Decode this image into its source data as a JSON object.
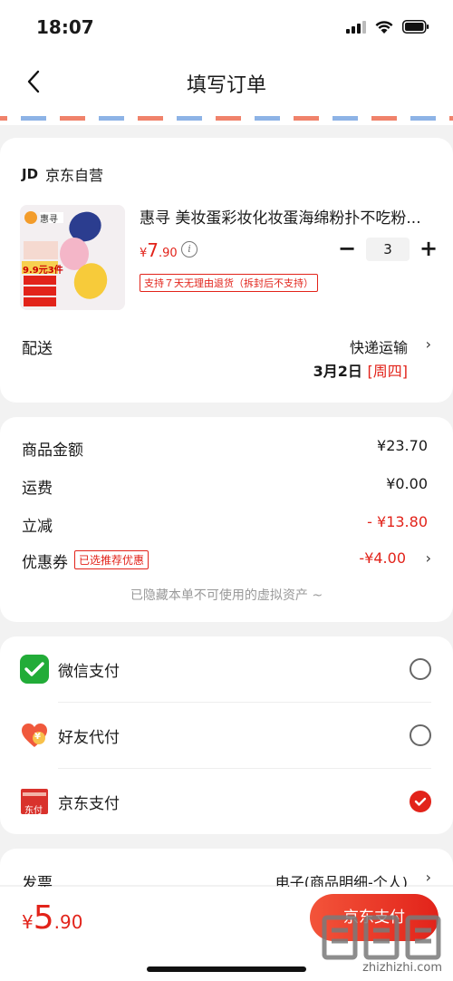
{
  "status": {
    "time": "18:07"
  },
  "nav": {
    "title": "填写订单"
  },
  "shop": {
    "logo": "JD",
    "name": "京东自营",
    "product": {
      "title": "惠寻  美妆蛋彩妆化妆蛋海绵粉扑不吃粉...",
      "price_currency": "¥",
      "price_int": "7",
      "price_dec": ".90",
      "quantity": "3",
      "minus_label": "−",
      "plus_label": "+",
      "return_tag": "支持７天无理由退货（拆封后不支持）",
      "image_brand": "惠寻",
      "image_promo": "9.9元3件"
    },
    "shipping": {
      "label": "配送",
      "method": "快递运输",
      "date": "3月2日",
      "weekday": "[周四]"
    }
  },
  "price": {
    "rows": [
      {
        "label": "商品金额",
        "value": "¥23.70"
      },
      {
        "label": "运费",
        "value": "¥0.00"
      },
      {
        "label": "立减",
        "value": "- ¥13.80"
      },
      {
        "label": "优惠券",
        "tag": "已选推荐优惠",
        "value": "-¥4.00"
      }
    ],
    "hidden_note": "已隐藏本单不可使用的虚拟资产 ~"
  },
  "payment": {
    "options": [
      {
        "label": "微信支付",
        "selected": false
      },
      {
        "label": "好友代付",
        "selected": false
      },
      {
        "label": "京东支付",
        "selected": true
      }
    ],
    "icon_texts": {
      "friend": "¥",
      "jd": "东付"
    }
  },
  "invoice": {
    "label": "发票",
    "value": "电子(商品明细-个人)"
  },
  "bottom": {
    "currency": "¥",
    "total_int": "5",
    "total_dec": ".90",
    "submit_label": "京东支付",
    "watermark": "zhizhizhi.com"
  },
  "colors": {
    "accent": "#e2231a",
    "wechat": "#22ac38"
  }
}
